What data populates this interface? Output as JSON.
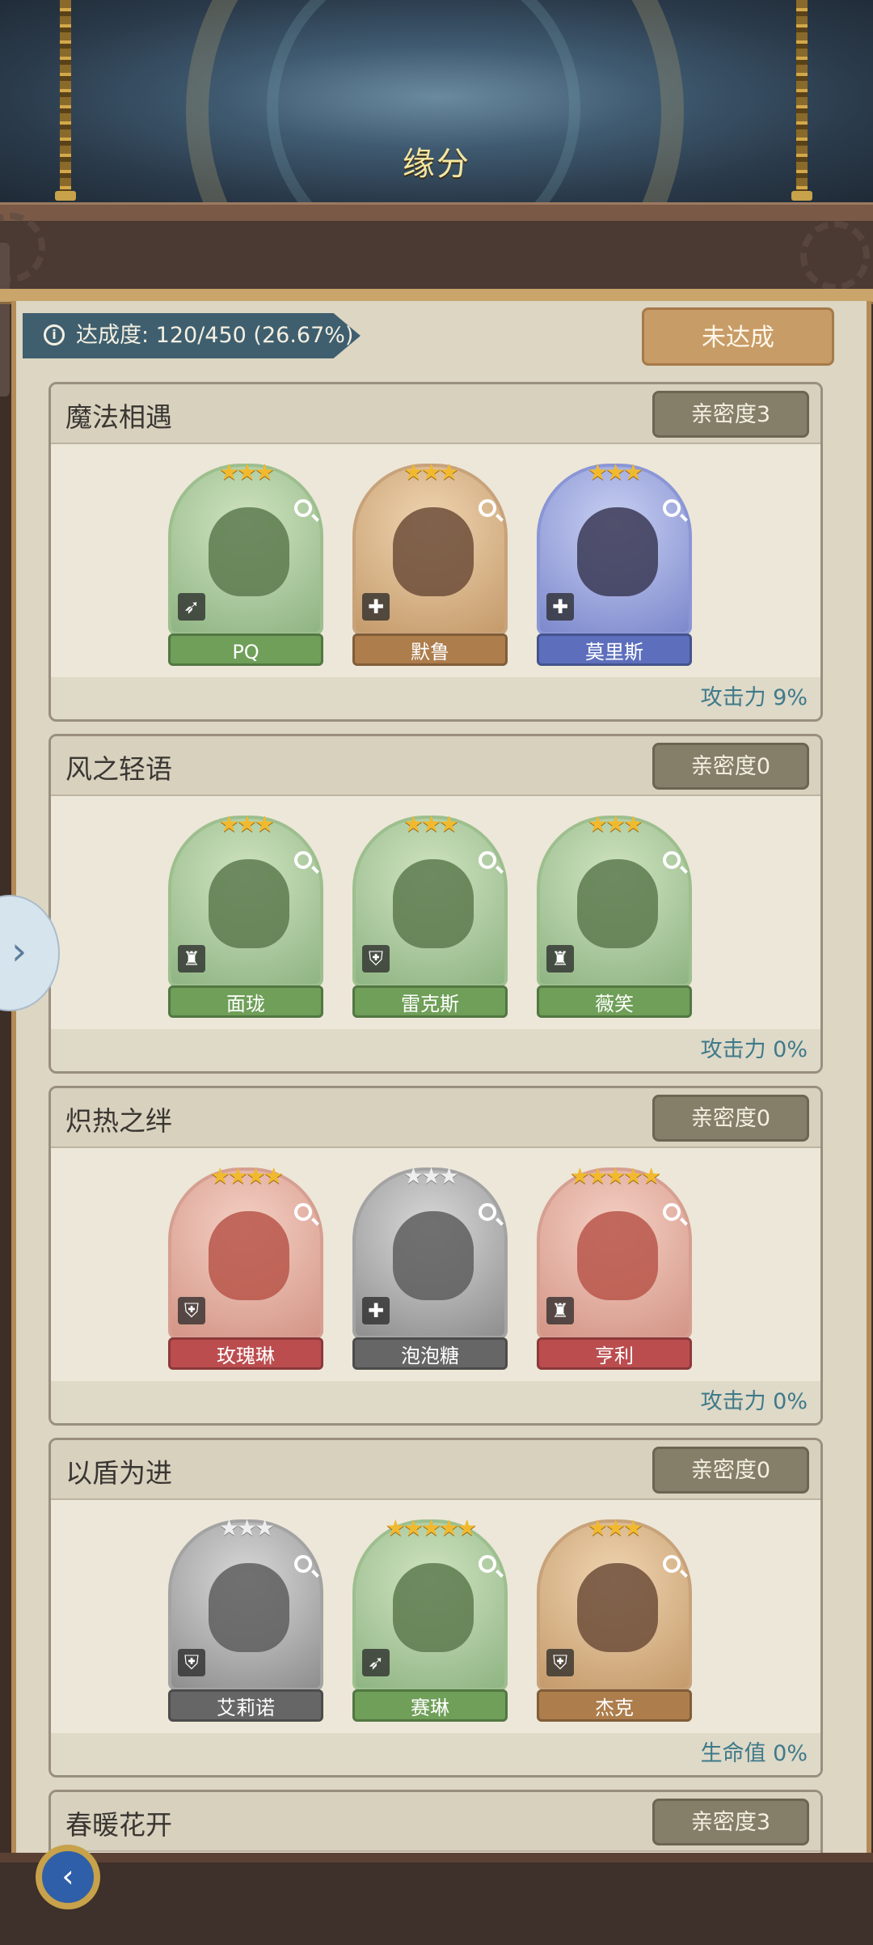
{
  "header": {
    "title": "缘分"
  },
  "progress": {
    "text": "达成度: 120/450 (26.67%)",
    "info_icon": "info-icon"
  },
  "status_button": {
    "label": "未达成"
  },
  "groups": [
    {
      "name": "魔法相遇",
      "affinity": "亲密度3",
      "bonus": "攻击力 9%",
      "heroes": [
        {
          "name": "PQ",
          "stars": "★★★",
          "role": "➶"
        },
        {
          "name": "默鲁",
          "stars": "★★★",
          "role": "✚"
        },
        {
          "name": "莫里斯",
          "stars": "★★★",
          "role": "✚"
        }
      ]
    },
    {
      "name": "风之轻语",
      "affinity": "亲密度0",
      "bonus": "攻击力 0%",
      "heroes": [
        {
          "name": "面珑",
          "stars": "★★★",
          "role": "♜"
        },
        {
          "name": "雷克斯",
          "stars": "★★★",
          "role": "⛨"
        },
        {
          "name": "薇笑",
          "stars": "★★★",
          "role": "♜"
        }
      ]
    },
    {
      "name": "炽热之绊",
      "affinity": "亲密度0",
      "bonus": "攻击力 0%",
      "heroes": [
        {
          "name": "玫瑰琳",
          "stars": "★★★★",
          "role": "⛨"
        },
        {
          "name": "泡泡糖",
          "stars": "★★★",
          "role": "✚"
        },
        {
          "name": "亨利",
          "stars": "★★★★★",
          "role": "♜"
        }
      ]
    },
    {
      "name": "以盾为进",
      "affinity": "亲密度0",
      "bonus": "生命值 0%",
      "heroes": [
        {
          "name": "艾莉诺",
          "stars": "★★★",
          "role": "⛨"
        },
        {
          "name": "赛琳",
          "stars": "★★★★★",
          "role": "➶"
        },
        {
          "name": "杰克",
          "stars": "★★★",
          "role": "⛨"
        }
      ]
    },
    {
      "name": "春暖花开",
      "affinity": "亲密度3"
    }
  ],
  "nav": {
    "back_label": "‹",
    "side_arrow": "›"
  }
}
